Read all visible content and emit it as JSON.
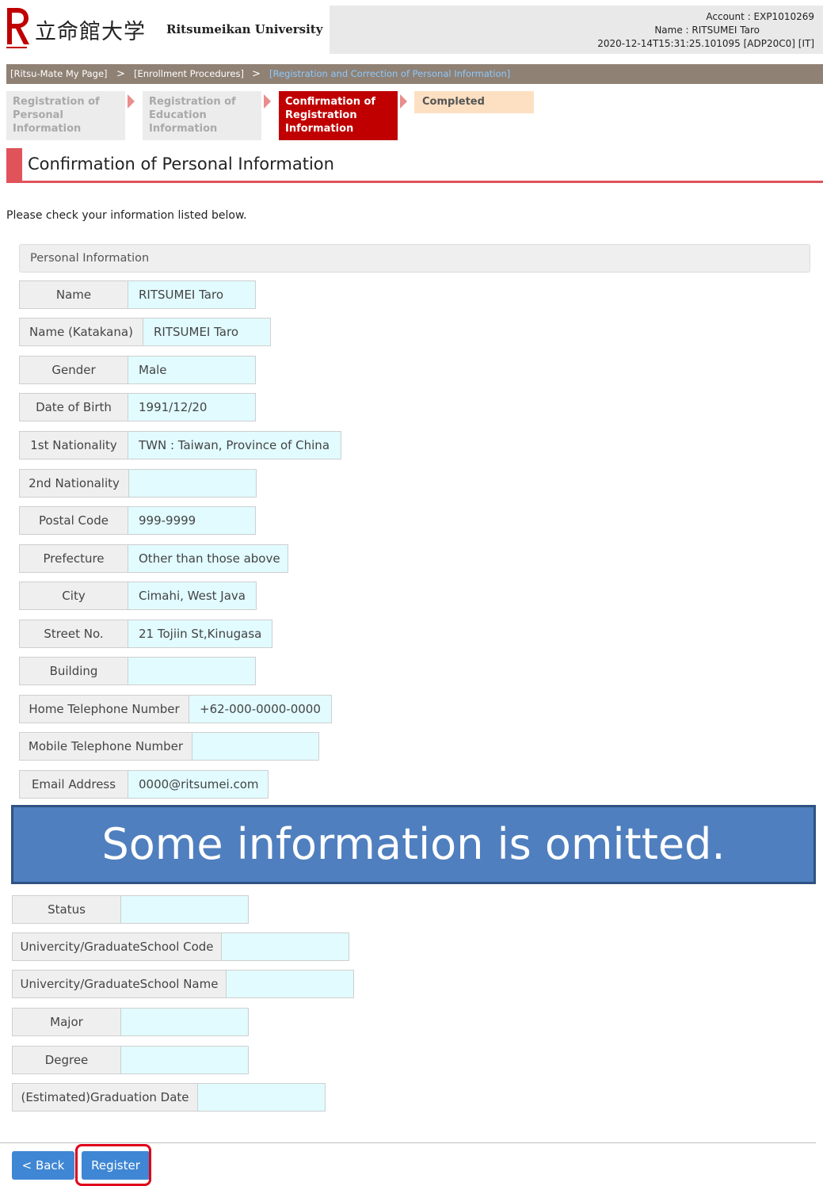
{
  "header": {
    "logo_jp": "立命館大学",
    "logo_en": "Ritsumeikan University",
    "account": "Account : EXP1010269",
    "name": "Name : RITSUMEI Taro",
    "session": "2020-12-14T15:31:25.101095 [ADP20C0] [IT]"
  },
  "breadcrumb": [
    "[Ritsu-Mate My Page]",
    "[Enrollment Procedures]",
    "[Registration and Correction of Personal Information]"
  ],
  "breadcrumb_sep": ">",
  "steps": [
    {
      "line1": "Registration of",
      "line2": "Personal",
      "line3": "Information"
    },
    {
      "line1": "Registration of",
      "line2": "Education",
      "line3": "Information"
    },
    {
      "line1": "Confirmation of",
      "line2": "Registration",
      "line3": "Information"
    },
    {
      "line1": "Completed"
    }
  ],
  "page_title": "Confirmation of Personal Information",
  "intro": "Please check your information listed below.",
  "section_title": "Personal Information",
  "fields": [
    {
      "label": "Name",
      "value": "RITSUMEI Taro"
    },
    {
      "label": "Name (Katakana)",
      "value": "RITSUMEI Taro"
    },
    {
      "label": "Gender",
      "value": "Male"
    },
    {
      "label": "Date of Birth",
      "value": "1991/12/20"
    },
    {
      "label": "1st Nationality",
      "value": "TWN : Taiwan, Province of China"
    },
    {
      "label": "2nd Nationality",
      "value": ""
    },
    {
      "label": "Postal Code",
      "value": "999-9999"
    },
    {
      "label": "Prefecture",
      "value": "Other than those above"
    },
    {
      "label": "City",
      "value": "Cimahi, West Java"
    },
    {
      "label": "Street No.",
      "value": "21 Tojiin St,Kinugasa"
    },
    {
      "label": "Building",
      "value": ""
    },
    {
      "label": "Home Telephone Number",
      "value": "+62-000-0000-0000"
    },
    {
      "label": "Mobile Telephone Number",
      "value": ""
    },
    {
      "label": "Email Address",
      "value": "0000@ritsumei.com"
    }
  ],
  "omitted_notice": "Some information is omitted.",
  "education_fields": [
    {
      "label": "Status",
      "value": ""
    },
    {
      "label": "Univercity/GraduateSchool Code",
      "value": ""
    },
    {
      "label": "Univercity/GraduateSchool Name",
      "value": ""
    },
    {
      "label": "Major",
      "value": ""
    },
    {
      "label": "Degree",
      "value": ""
    },
    {
      "label": "(Estimated)Graduation Date",
      "value": ""
    }
  ],
  "buttons": {
    "back": "< Back",
    "register": "Register"
  },
  "colors": {
    "brand_red": "#c00000",
    "button_blue": "#3f87d4",
    "value_bg": "#e1fbff"
  }
}
